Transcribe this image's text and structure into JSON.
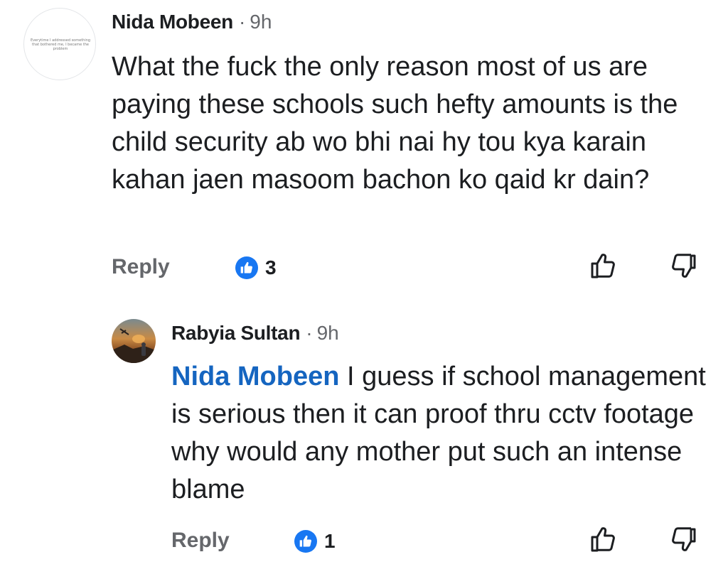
{
  "comments": [
    {
      "author": "Nida Mobeen",
      "time": "9h",
      "avatar_text": "Everytime I addressed something that bothered me, I became the problem",
      "text": "What the fuck the only reason most of us are paying these schools such hefty amounts is the child security ab wo bhi nai hy tou kya karain kahan jaen masoom bachon ko qaid kr dain?",
      "reply_label": "Reply",
      "like_count": "3",
      "like_icon": "thumbs-up-icon",
      "dislike_icon": "thumbs-down-icon"
    },
    {
      "author": "Rabyia Sultan",
      "time": "9h",
      "mention": "Nida Mobeen",
      "text": " I guess if school management is serious then it can proof thru cctv footage why would any mother put such an intense blame",
      "reply_label": "Reply",
      "like_count": "1",
      "like_icon": "thumbs-up-icon",
      "dislike_icon": "thumbs-down-icon"
    }
  ],
  "colors": {
    "like_badge": "#1877f2",
    "mention": "#1565c0",
    "secondary_text": "#65676b"
  }
}
